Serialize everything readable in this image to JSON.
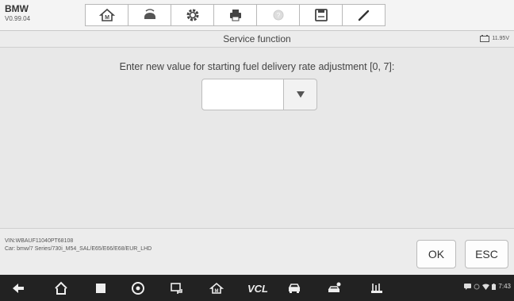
{
  "app": {
    "name": "BMW",
    "version": "V0.99.04"
  },
  "toolbar": {
    "items": [
      {
        "icon": "home-icon"
      },
      {
        "icon": "vehicle-swap-icon"
      },
      {
        "icon": "settings-gear-icon"
      },
      {
        "icon": "print-icon"
      },
      {
        "icon": "help-icon"
      },
      {
        "icon": "save-icon"
      },
      {
        "icon": "edit-icon"
      }
    ]
  },
  "titlebar": {
    "title": "Service function",
    "voltage": "11.95V"
  },
  "main": {
    "prompt": "Enter new value for starting fuel delivery rate adjustment [0, 7]:",
    "input_value": ""
  },
  "footer": {
    "vin": "VIN:WBAUF11040PT68108",
    "car": "Car: bmw/7 Series/730i_M54_SAL/E65/E66/E68/EUR_LHD",
    "ok_label": "OK",
    "esc_label": "ESC"
  },
  "navbar": {
    "vcl_label": "VCL",
    "time": "7:43"
  },
  "colors": {
    "navbar": "#222222",
    "toolbar": "#f4f4f4",
    "background": "#e9e9e9"
  }
}
